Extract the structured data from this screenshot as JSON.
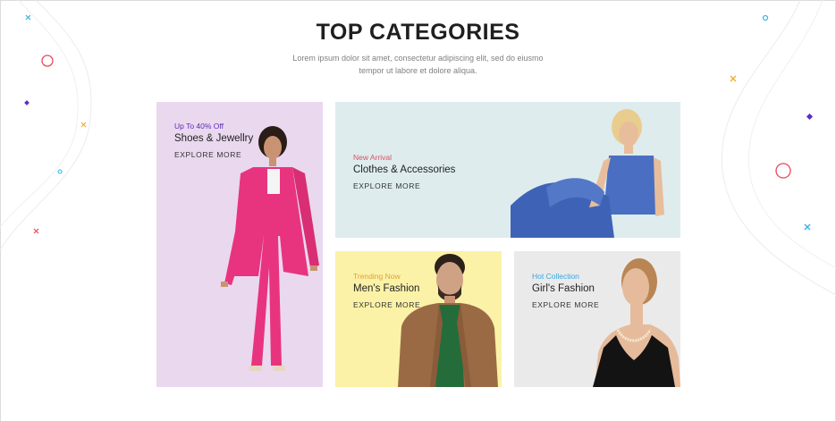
{
  "section": {
    "title": "TOP CATEGORIES",
    "subtitle_line1": "Lorem ipsum dolor sit amet, consectetur adipiscing elit, sed do eiusmo",
    "subtitle_line2": "tempor ut labore et dolore aliqua."
  },
  "categories": [
    {
      "tag": "Up To 40% Off",
      "name": "Shoes & Jewellry",
      "cta": "EXPLORE MORE",
      "tag_color": "#5a2bb8",
      "bg": "#ead8ef"
    },
    {
      "tag": "New Arrival",
      "name": "Clothes & Accessories",
      "cta": "EXPLORE MORE",
      "tag_color": "#e0505a",
      "bg": "#deecee"
    },
    {
      "tag": "Trending Now",
      "name": "Men's Fashion",
      "cta": "EXPLORE MORE",
      "tag_color": "#e0a23a",
      "bg": "#fbf2a7"
    },
    {
      "tag": "Hot Collection",
      "name": "Girl's Fashion",
      "cta": "EXPLORE MORE",
      "tag_color": "#37a7e0",
      "bg": "#eaeaea"
    }
  ],
  "decor_colors": {
    "red": "#e8495a",
    "blue": "#38b2e6",
    "gold": "#f2b02a",
    "purple": "#5b2bd0"
  }
}
